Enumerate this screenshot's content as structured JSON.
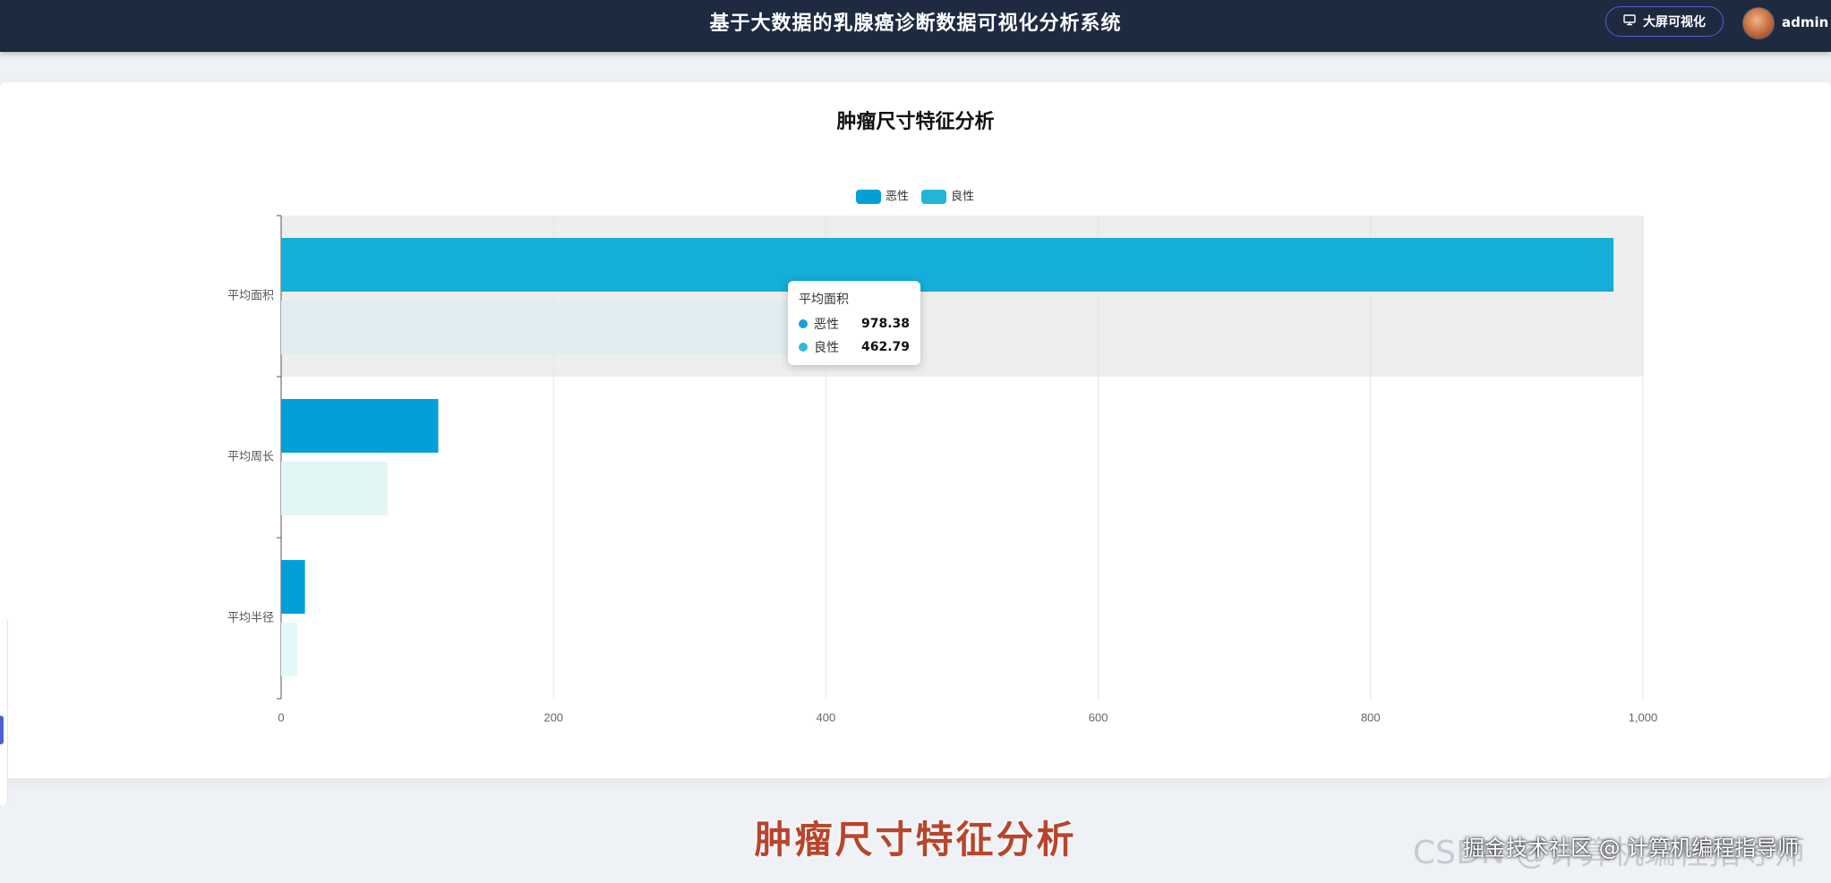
{
  "header": {
    "app_title": "基于大数据的乳腺癌诊断数据可视化分析系统",
    "bigscreen_label": "大屏可视化",
    "username": "admin"
  },
  "card": {
    "title": "肿瘤尺寸特征分析"
  },
  "chart_data": {
    "type": "bar",
    "orientation": "horizontal",
    "categories": [
      "平均面积",
      "平均周长",
      "平均半径"
    ],
    "series": [
      {
        "name": "恶性",
        "color": "#039fd9",
        "values": [
          978.38,
          115.4,
          17.5
        ]
      },
      {
        "name": "良性",
        "color": "#22b5d8",
        "values": [
          462.79,
          78.1,
          12.1
        ]
      }
    ],
    "xlim": [
      0,
      1000
    ],
    "xticks": [
      "0",
      "200",
      "400",
      "600",
      "800",
      "1,000"
    ],
    "grid": true,
    "legend_position": "top-center",
    "highlighted_category": "平均面积"
  },
  "tooltip": {
    "title": "平均面积",
    "rows": [
      {
        "name": "恶性",
        "value": "978.38",
        "color": "#1a9fd6"
      },
      {
        "name": "良性",
        "value": "462.79",
        "color": "#33b7d9"
      }
    ]
  },
  "caption": "肿瘤尺寸特征分析",
  "watermark": {
    "back": "CSDN @计算机编程指导师",
    "front": "掘金技术社区 @ 计算机编程指导师"
  }
}
